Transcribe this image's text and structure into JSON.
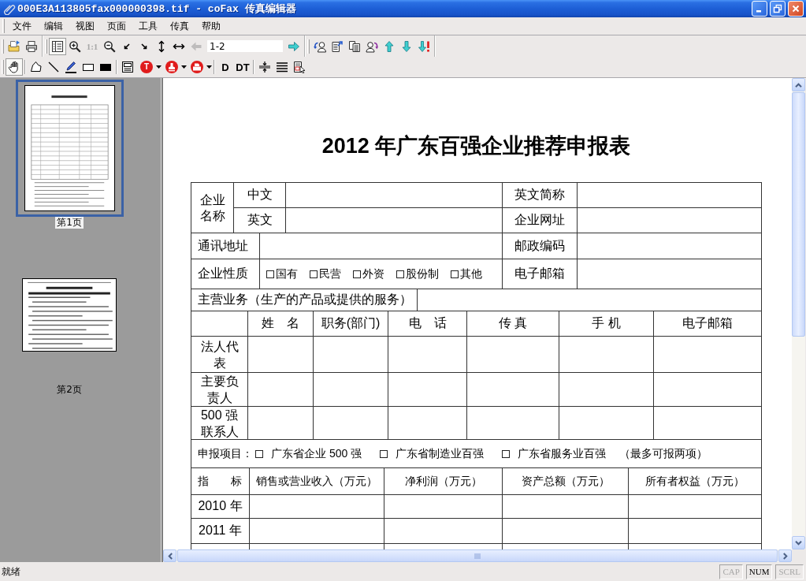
{
  "window": {
    "title": "000E3A113805fax000000398.tif - coFax 传真编辑器"
  },
  "menu": [
    "文件",
    "编辑",
    "视图",
    "页面",
    "工具",
    "传真",
    "帮助"
  ],
  "toolbars": [
    {
      "kind": "bands",
      "groups": [
        [
          {
            "kind": "icon",
            "pressed": false,
            "disabled": false
          },
          {
            "kind": "icon",
            "pressed": false,
            "disabled": false
          }
        ],
        [
          {
            "kind": "icon",
            "pressed": true,
            "disabled": false
          },
          {
            "kind": "icon",
            "pressed": false,
            "disabled": false
          },
          {
            "kind": "text",
            "label": "1:1",
            "pressed": false,
            "disabled": true
          },
          {
            "kind": "icon",
            "pressed": false,
            "disabled": false
          },
          {
            "kind": "icon",
            "pressed": false,
            "disabled": false
          },
          {
            "kind": "icon",
            "pressed": false,
            "disabled": false
          },
          {
            "kind": "icon",
            "pressed": false,
            "disabled": false
          },
          {
            "kind": "icon",
            "pressed": false,
            "disabled": false
          },
          {
            "kind": "icon",
            "pressed": false,
            "disabled": true
          },
          {
            "kind": "field",
            "value": "1-2"
          },
          {
            "kind": "icon",
            "pressed": false,
            "disabled": false
          }
        ],
        [
          {
            "kind": "icon",
            "pressed": false,
            "disabled": false
          },
          {
            "kind": "icon",
            "pressed": false,
            "disabled": false
          },
          {
            "kind": "icon",
            "pressed": false,
            "disabled": false
          },
          {
            "kind": "icon",
            "pressed": false,
            "disabled": false
          },
          {
            "kind": "icon",
            "pressed": false,
            "disabled": false
          },
          {
            "kind": "icon",
            "pressed": false,
            "disabled": false
          },
          {
            "kind": "icon",
            "pressed": false,
            "disabled": false
          }
        ]
      ]
    },
    {
      "kind": "plain",
      "groups": [
        [
          {
            "kind": "icon",
            "pressed": true,
            "disabled": false
          }
        ],
        [
          {
            "kind": "icon",
            "pressed": false,
            "disabled": false
          },
          {
            "kind": "icon",
            "pressed": false,
            "disabled": false
          },
          {
            "kind": "icon",
            "pressed": false,
            "disabled": false
          },
          {
            "kind": "icon",
            "pressed": false,
            "disabled": false
          },
          {
            "kind": "icon",
            "pressed": false,
            "disabled": false
          }
        ],
        [
          {
            "kind": "icon",
            "pressed": false,
            "disabled": false
          },
          {
            "kind": "disc-menu",
            "label": "T",
            "pressed": false,
            "disabled": false
          },
          {
            "kind": "icon-menu",
            "pressed": false,
            "disabled": false
          },
          {
            "kind": "icon-menu",
            "pressed": false,
            "disabled": false
          }
        ],
        [
          {
            "kind": "text",
            "label": "D",
            "pressed": false,
            "disabled": false
          },
          {
            "kind": "text",
            "label": "DT",
            "pressed": false,
            "disabled": false
          }
        ],
        [
          {
            "kind": "icon",
            "pressed": false,
            "disabled": false
          },
          {
            "kind": "icon",
            "pressed": false,
            "disabled": false
          },
          {
            "kind": "icon",
            "pressed": false,
            "disabled": false
          }
        ]
      ]
    }
  ],
  "pages": [
    {
      "label": "第1页",
      "selected": true
    },
    {
      "label": "第2页",
      "selected": false
    }
  ],
  "document": {
    "title": "2012 年广东百强企业推荐申报表",
    "name_block": {
      "label": "企业名称",
      "rows": [
        {
          "label": "中文",
          "side_label": "英文简称"
        },
        {
          "label": "英文",
          "side_label": "企业网址"
        }
      ]
    },
    "info_rows": [
      {
        "label": "通讯地址",
        "side_label": "邮政编码"
      },
      {
        "label": "企业性质",
        "options": [
          {
            "label": "国有",
            "checked": false
          },
          {
            "label": "民营",
            "checked": false
          },
          {
            "label": "外资",
            "checked": false
          },
          {
            "label": "股份制",
            "checked": false
          },
          {
            "label": "其他",
            "checked": false
          }
        ],
        "side_label": "电子邮箱"
      }
    ],
    "business": {
      "label": "主营业务（生产的产品或提供的服务）"
    },
    "contacts": {
      "columns": [
        "姓　名",
        "职务(部门)",
        "电　话",
        "传 真",
        "手 机",
        "电子邮箱"
      ],
      "rows": [
        "法人代表",
        "主要负责人",
        "500 强联系人"
      ]
    },
    "declaration": {
      "label": "申报项目：",
      "options": [
        {
          "label": "广东省企业 500 强",
          "checked": false
        },
        {
          "label": "广东省制造业百强",
          "checked": false
        },
        {
          "label": "广东省服务业百强",
          "checked": false
        }
      ],
      "note": "（最多可报两项）"
    },
    "indicators": {
      "columns": [
        "指　　标",
        "销售或营业收入（万元）",
        "净利润（万元）",
        "资产总额（万元）",
        "所有者权益（万元）"
      ],
      "rows": [
        "2010 年",
        "2011 年"
      ]
    }
  },
  "status_bar": {
    "text": "就绪",
    "indicators": [
      {
        "label": "CAP",
        "on": false
      },
      {
        "label": "NUM",
        "on": true
      },
      {
        "label": "SCRL",
        "on": false
      }
    ]
  }
}
